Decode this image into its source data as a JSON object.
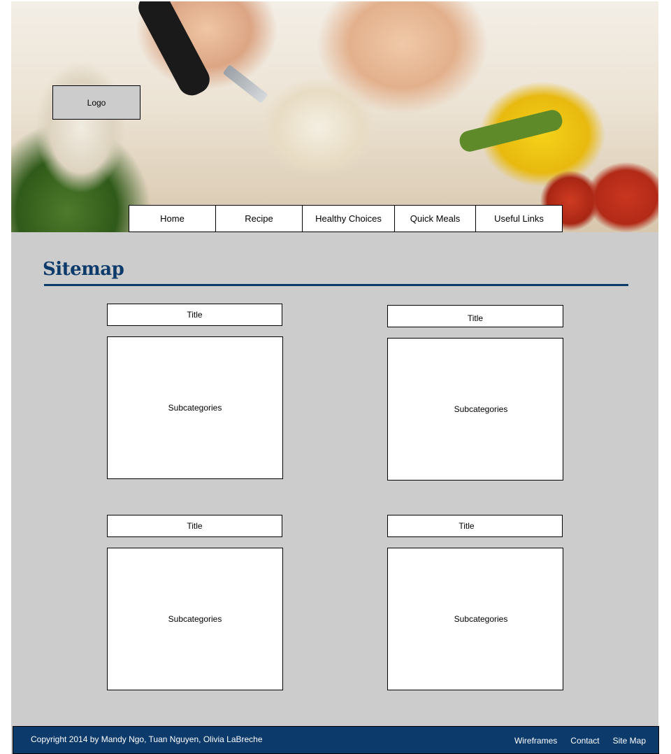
{
  "header": {
    "logo": "Logo"
  },
  "nav": {
    "items": [
      {
        "label": "Home"
      },
      {
        "label": "Recipe"
      },
      {
        "label": "Healthy Choices"
      },
      {
        "label": "Quick Meals"
      },
      {
        "label": "Useful Links"
      }
    ]
  },
  "main": {
    "title": "Sitemap",
    "sections": [
      {
        "title": "Title",
        "body": "Subcategories"
      },
      {
        "title": "Title",
        "body": "Subcategories"
      },
      {
        "title": "Title",
        "body": "Subcategories"
      },
      {
        "title": "Title",
        "body": "Subcategories"
      }
    ]
  },
  "footer": {
    "copyright": "Copyright  2014 by Mandy Ngo, Tuan Nguyen, Olivia LaBreche",
    "links": [
      {
        "label": "Wireframes"
      },
      {
        "label": "Contact"
      },
      {
        "label": "Site Map"
      }
    ]
  },
  "colors": {
    "accent": "#0c3a6b",
    "background": "#cccccc"
  }
}
